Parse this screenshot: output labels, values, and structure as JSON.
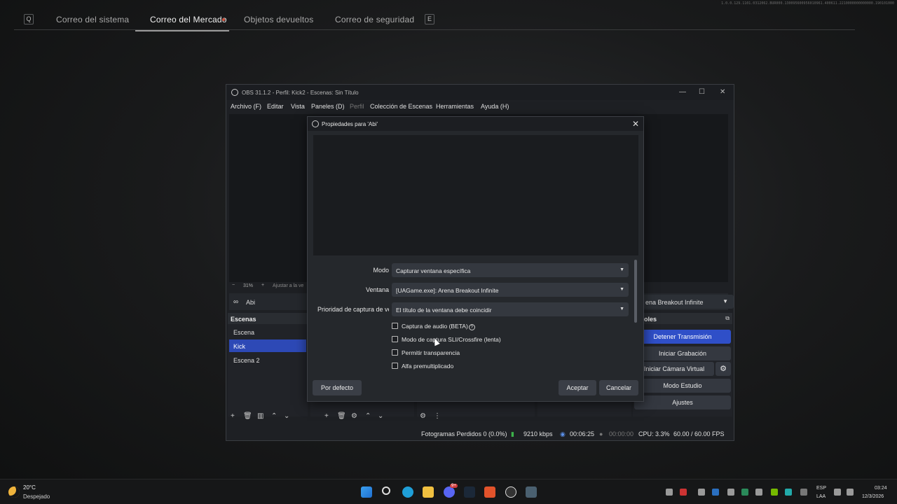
{
  "game": {
    "key_left": "Q",
    "key_right": "E",
    "tabs": [
      {
        "label": "Correo del sistema"
      },
      {
        "label": "Correo del Mercado"
      },
      {
        "label": "Objetos devueltos"
      },
      {
        "label": "Correo de seguridad"
      }
    ],
    "version": "1.0.0.129.1101.0312062.BUR000.130095600956010961.400611.2210000000000000.190101000"
  },
  "obs": {
    "title": "OBS 31.1.2 - Perfil: Kick2 - Escenas: Sin Título",
    "menu": {
      "archivo": "Archivo (F)",
      "editar": "Editar",
      "vista": "Vista",
      "paneles": "Paneles (D)",
      "perfil": "Perfil",
      "coleccion": "Colección de Escenas",
      "herramientas": "Herramientas",
      "ayuda": "Ayuda (H)"
    },
    "zoom": "31%",
    "zoom_fit": "Ajustar a la ve",
    "source_name": "Abi",
    "window_select": "ena Breakout Infinite",
    "scenes_header": "Escenas",
    "scenes": [
      "Escena",
      "Kick",
      "Escena 2"
    ],
    "controls_header": "ntroles",
    "controls": {
      "stop_stream": "Detener Transmisión",
      "start_record": "Iniciar Grabación",
      "start_vcam": "Iniciar Cámara Virtual",
      "studio_mode": "Modo Estudio",
      "settings": "Ajustes"
    },
    "status": {
      "dropped_frames": "Fotogramas Perdidos 0 (0.0%)",
      "bitrate": "9210 kbps",
      "stream_time": "00:06:25",
      "record_time": "00:00:00",
      "cpu": "CPU: 3.3%",
      "fps": "60.00 / 60.00 FPS"
    }
  },
  "dialog": {
    "title": "Propiedades para 'Abi'",
    "labels": {
      "mode": "Modo",
      "window": "Ventana",
      "priority": "Prioridad de captura de ve"
    },
    "values": {
      "mode": "Capturar ventana específica",
      "window": "[UAGame.exe]: Arena Breakout Infinite",
      "priority": "El título de la ventana debe coincidir"
    },
    "checkboxes": [
      {
        "label": "Captura de audio (BETA)"
      },
      {
        "label": "Modo de captura SLI/Crossfire (lenta)"
      },
      {
        "label": "Permitir transparencia"
      },
      {
        "label": "Alfa premultiplicado"
      }
    ],
    "buttons": {
      "defaults": "Por defecto",
      "accept": "Aceptar",
      "cancel": "Cancelar"
    }
  },
  "taskbar": {
    "weather_temp": "20°C",
    "weather_cond": "Despejado",
    "discord_badge": "9+",
    "lang": "ESP",
    "layout": "LAA",
    "time": "03:24",
    "date": "12/3/2026"
  }
}
